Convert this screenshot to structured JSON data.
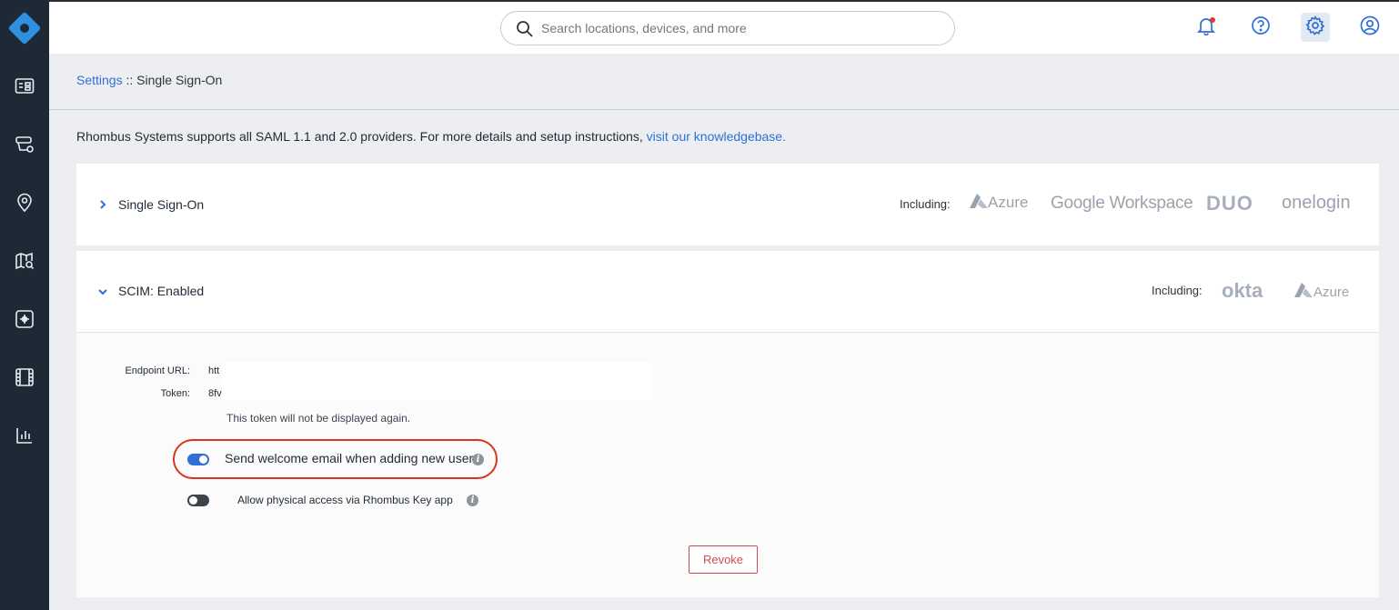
{
  "topbar": {
    "search_placeholder": "Search locations, devices, and more",
    "notification_dot_color": "#d63b2f"
  },
  "sidebar": {
    "items": [
      {
        "icon": "dashboard-icon"
      },
      {
        "icon": "devices-icon"
      },
      {
        "icon": "location-pin-icon"
      },
      {
        "icon": "map-search-icon"
      },
      {
        "icon": "integrations-icon"
      },
      {
        "icon": "video-film-icon"
      },
      {
        "icon": "reports-chart-icon"
      }
    ]
  },
  "breadcrumb": {
    "root": "Settings",
    "separator": " :: ",
    "current": "Single Sign-On"
  },
  "intro": {
    "text": "Rhombus Systems supports all SAML 1.1 and 2.0 providers. For more details and setup instructions, ",
    "link": "visit our knowledgebase."
  },
  "sso_panel": {
    "title": "Single Sign-On",
    "expanded": false,
    "including_label": "Including:",
    "brands": [
      "Azure",
      "Google Workspace",
      "DUO",
      "onelogin"
    ]
  },
  "scim_panel": {
    "title": "SCIM: Enabled",
    "expanded": true,
    "including_label": "Including:",
    "brands": [
      "okta",
      "Azure"
    ],
    "endpoint_label": "Endpoint URL:",
    "endpoint_value": "htt",
    "token_label": "Token:",
    "token_value": "8fv",
    "token_note": "This token will not be displayed again.",
    "welcome_toggle": {
      "label": "Send welcome email when adding new users.",
      "on": true
    },
    "physical_toggle": {
      "label": "Allow physical access via Rhombus Key app",
      "on": false
    },
    "revoke_label": "Revoke"
  },
  "colors": {
    "accent": "#2f6fd6",
    "sidebar": "#1d2a36",
    "highlight_ring": "#d8341f",
    "danger": "#d04a55"
  }
}
